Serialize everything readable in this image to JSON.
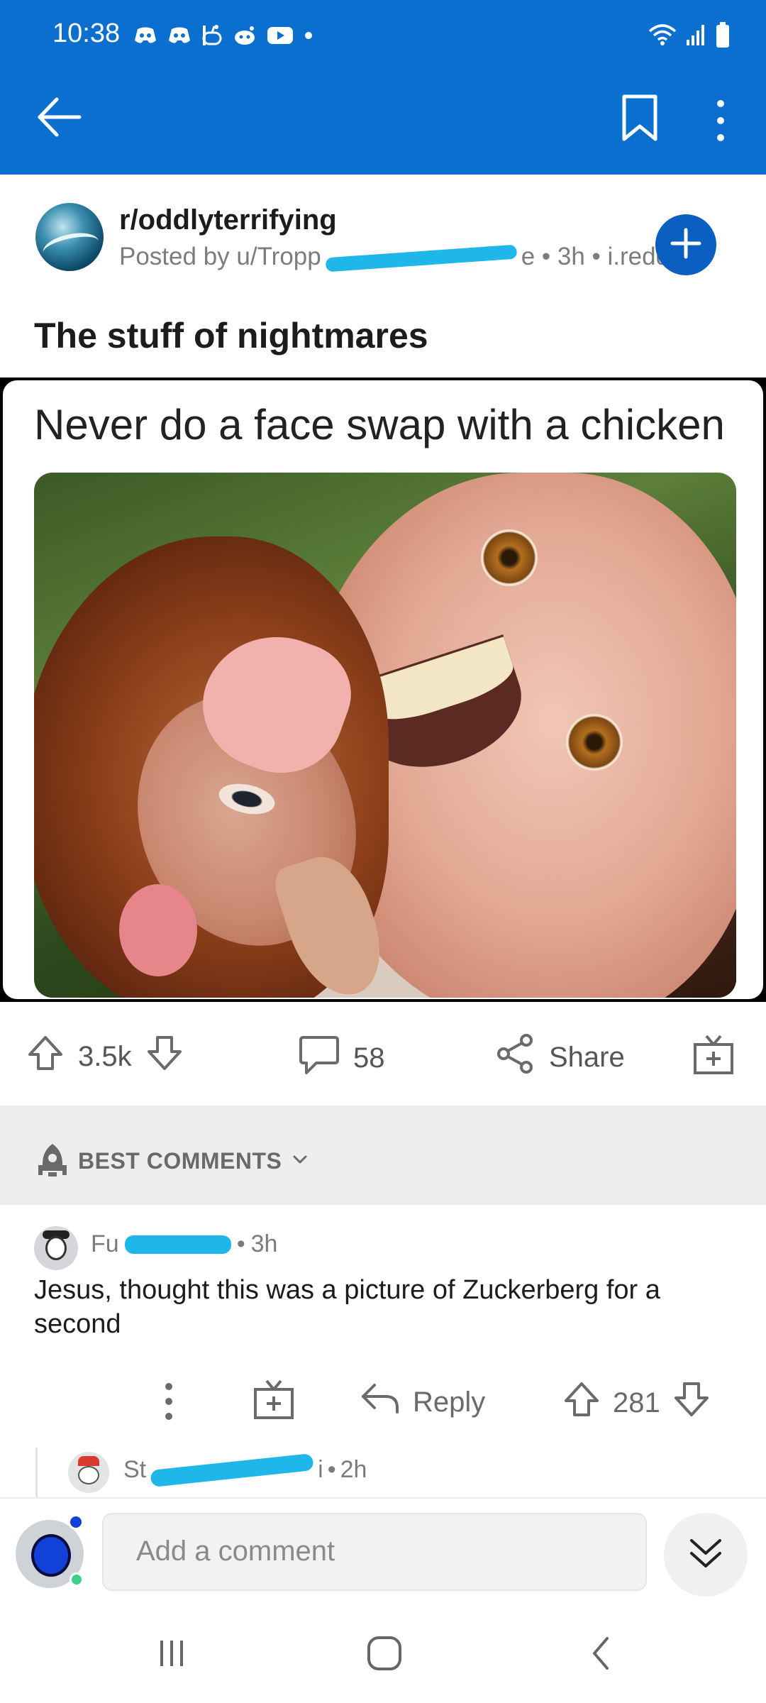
{
  "status_bar": {
    "time": "10:38",
    "notification_icons": [
      "discord-icon",
      "discord-icon",
      "reddit-icon",
      "reddit-icon",
      "youtube-icon",
      "dot-icon"
    ],
    "system_icons": [
      "wifi-icon",
      "signal-icon",
      "battery-icon"
    ]
  },
  "app_bar": {
    "back_icon": "arrow-left-icon",
    "bookmark_icon": "bookmark-icon",
    "more_icon": "more-vertical-icon",
    "color": "#0b6fcf"
  },
  "post": {
    "subreddit": "r/oddlyterrifying",
    "posted_by_prefix": "Posted by",
    "username_partial": "u/Tropp",
    "username_suffix": "e",
    "age": "3h",
    "domain": "i.redd.it",
    "title": "The stuff of nightmares",
    "image_caption": "Never do a face swap with a chicken",
    "join_icon": "plus-icon"
  },
  "actions": {
    "score": "3.5k",
    "comments": "58",
    "share_label": "Share",
    "award_icon": "gift-icon"
  },
  "sort": {
    "label": "BEST COMMENTS"
  },
  "comment": {
    "author_partial": "Fu",
    "age": "3h",
    "text": "Jesus, thought this was a picture of Zuckerberg for a second",
    "reply_label": "Reply",
    "score": "281"
  },
  "reply_preview": {
    "author_partial": "St",
    "author_suffix": "i",
    "age": "2h"
  },
  "composer": {
    "placeholder": "Add a comment"
  },
  "colors": {
    "brand_blue": "#0b6fcf",
    "redaction": "#1fb7ea",
    "join_button": "#0b5fc0"
  }
}
